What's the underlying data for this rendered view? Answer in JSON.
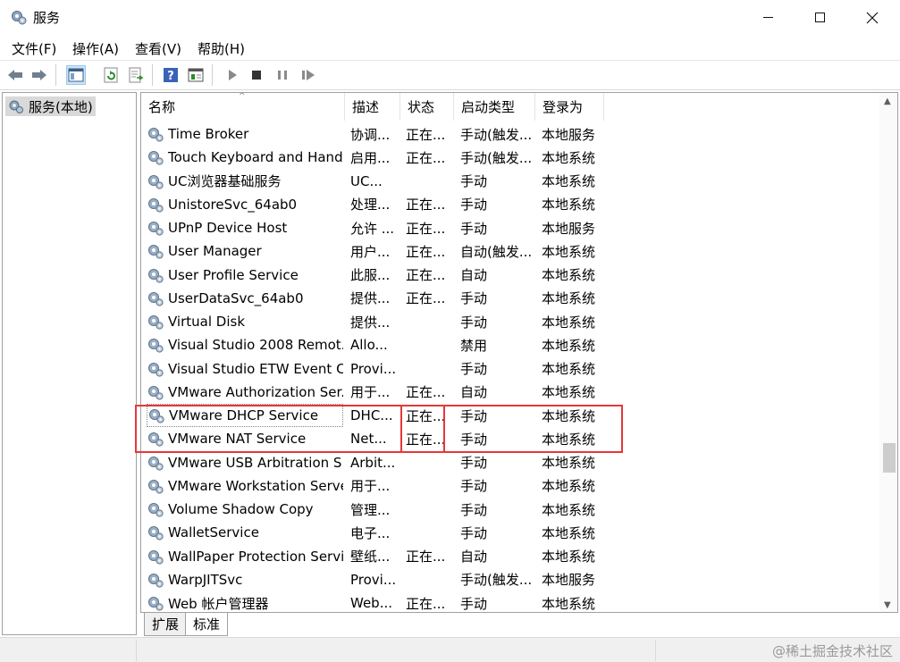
{
  "window": {
    "title": "服务"
  },
  "menu": [
    "文件(F)",
    "操作(A)",
    "查看(V)",
    "帮助(H)"
  ],
  "toolbar": [
    "back-arrow-icon",
    "forward-arrow-icon",
    "show-hide-tree-icon",
    "refresh-icon",
    "export-list-icon",
    "help-icon",
    "properties-icon",
    "start-service-icon",
    "stop-service-icon",
    "pause-service-icon",
    "restart-service-icon"
  ],
  "tree": {
    "root": "服务(本地)"
  },
  "columns": [
    "名称",
    "描述",
    "状态",
    "启动类型",
    "登录为"
  ],
  "services": [
    {
      "name": "Time Broker",
      "desc": "协调...",
      "state": "正在...",
      "start": "手动(触发...",
      "logon": "本地服务"
    },
    {
      "name": "Touch Keyboard and Hand...",
      "desc": "启用...",
      "state": "正在...",
      "start": "手动(触发...",
      "logon": "本地系统"
    },
    {
      "name": "UC浏览器基础服务",
      "desc": "UC...",
      "state": "",
      "start": "手动",
      "logon": "本地系统"
    },
    {
      "name": "UnistoreSvc_64ab0",
      "desc": "处理...",
      "state": "正在...",
      "start": "手动",
      "logon": "本地系统"
    },
    {
      "name": "UPnP Device Host",
      "desc": "允许 ...",
      "state": "正在...",
      "start": "手动",
      "logon": "本地服务"
    },
    {
      "name": "User Manager",
      "desc": "用户...",
      "state": "正在...",
      "start": "自动(触发...",
      "logon": "本地系统"
    },
    {
      "name": "User Profile Service",
      "desc": "此服...",
      "state": "正在...",
      "start": "自动",
      "logon": "本地系统"
    },
    {
      "name": "UserDataSvc_64ab0",
      "desc": "提供...",
      "state": "正在...",
      "start": "手动",
      "logon": "本地系统"
    },
    {
      "name": "Virtual Disk",
      "desc": "提供...",
      "state": "",
      "start": "手动",
      "logon": "本地系统"
    },
    {
      "name": "Visual Studio 2008 Remot...",
      "desc": "Allo...",
      "state": "",
      "start": "禁用",
      "logon": "本地系统"
    },
    {
      "name": "Visual Studio ETW Event C...",
      "desc": "Provi...",
      "state": "",
      "start": "手动",
      "logon": "本地系统"
    },
    {
      "name": "VMware Authorization Ser...",
      "desc": "用于...",
      "state": "正在...",
      "start": "自动",
      "logon": "本地系统"
    },
    {
      "name": "VMware DHCP Service",
      "desc": "DHC...",
      "state": "正在...",
      "start": "手动",
      "logon": "本地系统"
    },
    {
      "name": "VMware NAT Service",
      "desc": "Net...",
      "state": "正在...",
      "start": "手动",
      "logon": "本地系统"
    },
    {
      "name": "VMware USB Arbitration S...",
      "desc": "Arbit...",
      "state": "",
      "start": "手动",
      "logon": "本地系统"
    },
    {
      "name": "VMware Workstation Server",
      "desc": "用于...",
      "state": "",
      "start": "手动",
      "logon": "本地系统"
    },
    {
      "name": "Volume Shadow Copy",
      "desc": "管理...",
      "state": "",
      "start": "手动",
      "logon": "本地系统"
    },
    {
      "name": "WalletService",
      "desc": "电子...",
      "state": "",
      "start": "手动",
      "logon": "本地系统"
    },
    {
      "name": "WallPaper Protection Servi...",
      "desc": "壁纸...",
      "state": "正在...",
      "start": "自动",
      "logon": "本地系统"
    },
    {
      "name": "WarpJITSvc",
      "desc": "Provi...",
      "state": "",
      "start": "手动(触发...",
      "logon": "本地服务"
    },
    {
      "name": "Web 帐户管理器",
      "desc": "Web...",
      "state": "正在...",
      "start": "手动",
      "logon": "本地系统"
    }
  ],
  "tabs": [
    "扩展",
    "标准"
  ],
  "watermark": "@稀土掘金技术社区",
  "colors": {
    "highlight": "#e53838",
    "selection": "#d9d9d9"
  }
}
